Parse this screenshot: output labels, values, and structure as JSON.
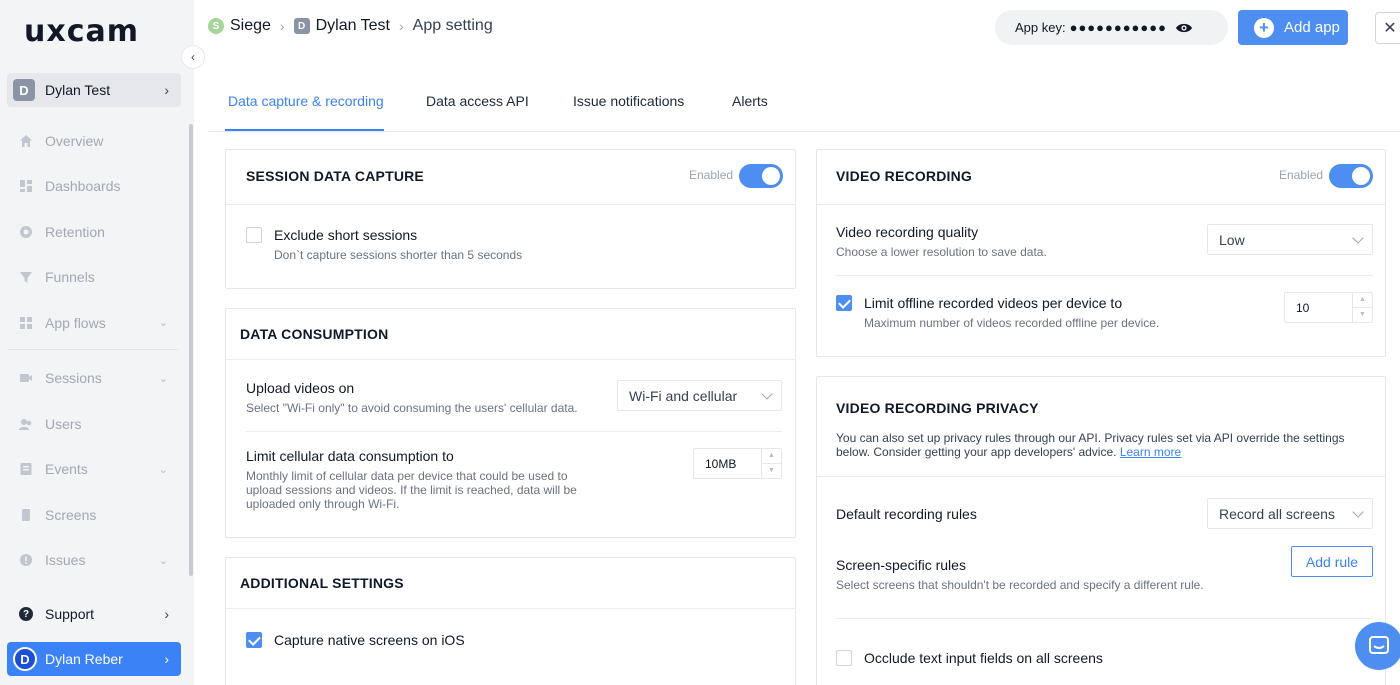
{
  "sidebar": {
    "logo": "uxcam",
    "workspace": {
      "initial": "D",
      "name": "Dylan Test"
    },
    "nav": [
      {
        "label": "Overview",
        "icon": "home-icon"
      },
      {
        "label": "Dashboards",
        "icon": "dashboard-icon"
      },
      {
        "label": "Retention",
        "icon": "retention-icon"
      },
      {
        "label": "Funnels",
        "icon": "funnel-icon"
      },
      {
        "label": "App flows",
        "icon": "app-flows-icon",
        "expandable": true
      },
      {
        "label": "Sessions",
        "icon": "sessions-icon",
        "expandable": true
      },
      {
        "label": "Users",
        "icon": "users-icon"
      },
      {
        "label": "Events",
        "icon": "events-icon",
        "expandable": true
      },
      {
        "label": "Screens",
        "icon": "screens-icon"
      },
      {
        "label": "Issues",
        "icon": "issues-icon",
        "expandable": true
      }
    ],
    "support": "Support",
    "user": {
      "initial": "D",
      "name": "Dylan Reber"
    }
  },
  "header": {
    "breadcrumb": [
      {
        "initial": "S",
        "label": "Siege",
        "color": "#a7d49b"
      },
      {
        "initial": "D",
        "label": "Dylan Test",
        "color": "#8a94a6"
      },
      {
        "label": "App setting"
      }
    ],
    "app_key_label": "App key:",
    "app_key_masked": "●●●●●●●●●●●",
    "add_app": "Add app"
  },
  "tabs": [
    {
      "label": "Data capture & recording",
      "active": true
    },
    {
      "label": "Data access API",
      "active": false
    },
    {
      "label": "Issue notifications",
      "active": false
    },
    {
      "label": "Alerts",
      "active": false
    }
  ],
  "session_capture": {
    "title": "SESSION DATA CAPTURE",
    "status": "Enabled",
    "enabled": true,
    "exclude_label": "Exclude short sessions",
    "exclude_sub": "Don`t capture sessions shorter than 5 seconds",
    "exclude_checked": false
  },
  "data_consumption": {
    "title": "DATA CONSUMPTION",
    "upload_label": "Upload videos on",
    "upload_sub": "Select \"Wi-Fi only\" to avoid consuming the users' cellular data.",
    "upload_value": "Wi-Fi and cellular",
    "limit_label": "Limit cellular data consumption to",
    "limit_sub": "Monthly limit of cellular data per device that could be used to upload sessions and videos. If the limit is reached, data will be uploaded only through Wi-Fi.",
    "limit_value": "10MB"
  },
  "additional": {
    "title": "ADDITIONAL SETTINGS",
    "capture_ios_label": "Capture native screens on iOS",
    "capture_ios_checked": true
  },
  "video_recording": {
    "title": "VIDEO RECORDING",
    "status": "Enabled",
    "enabled": true,
    "quality_label": "Video recording quality",
    "quality_sub": "Choose a lower resolution to save data.",
    "quality_value": "Low",
    "limit_label": "Limit offline recorded videos per device to",
    "limit_sub": "Maximum number of videos recorded offline per device.",
    "limit_checked": true,
    "limit_value": "10"
  },
  "video_privacy": {
    "title": "VIDEO RECORDING PRIVACY",
    "desc": "You can also set up privacy rules through our API. Privacy rules set via API override the settings below. Consider getting your app developers' advice.",
    "learn_more": "Learn more",
    "default_rules_label": "Default recording rules",
    "default_rules_value": "Record all screens",
    "screen_rules_label": "Screen-specific rules",
    "screen_rules_sub": "Select screens that shouldn't be recorded and specify a different rule.",
    "add_rule": "Add rule",
    "occlude_label": "Occlude text input fields on all screens",
    "occlude_checked": false
  }
}
